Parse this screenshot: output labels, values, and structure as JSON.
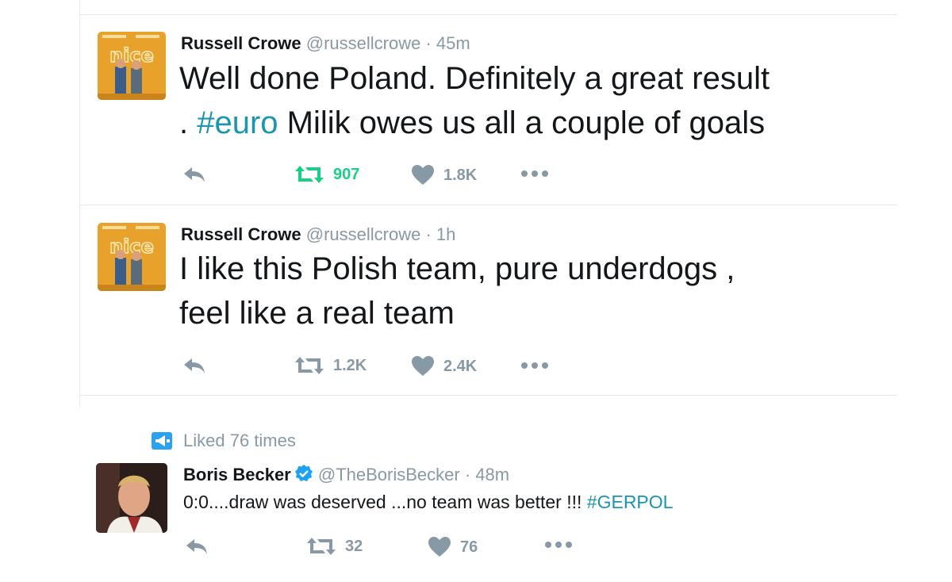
{
  "tweets": [
    {
      "name": "Russell Crowe",
      "handle": "@russellcrowe",
      "sep": "·",
      "time": "45m",
      "text_line1": "Well done Poland. Definitely a great result",
      "text_line2_prefix": ". ",
      "hashtag": "#euro",
      "text_line2_suffix": " Milik owes us all a couple of goals",
      "retweets": "907",
      "likes": "1.8K",
      "retweeted": true
    },
    {
      "name": "Russell Crowe",
      "handle": "@russellcrowe",
      "sep": "·",
      "time": "1h",
      "text_line1": "I like this Polish team, pure underdogs ,",
      "text_line2": "feel like a real team",
      "retweets": "1.2K",
      "likes": "2.4K",
      "retweeted": false
    },
    {
      "context": "Liked 76 times",
      "name": "Boris Becker",
      "handle": "@TheBorisBecker",
      "sep": "·",
      "time": "48m",
      "text": "0:0....draw was deserved ...no team was better !!! ",
      "hashtag": "#GERPOL",
      "retweets": "32",
      "likes": "76",
      "verified": true
    }
  ],
  "colors": {
    "text": "#14171a",
    "muted": "#8899a6",
    "hashtag": "#1b95b0",
    "retweet_active": "#19cf86",
    "verified": "#1da1f2",
    "liked_icon": "#2aa3ef",
    "avatar_poster": "#e8a22b"
  },
  "icons": [
    "reply-icon",
    "retweet-icon",
    "like-icon",
    "more-icon",
    "verified-icon",
    "liked-context-icon"
  ]
}
